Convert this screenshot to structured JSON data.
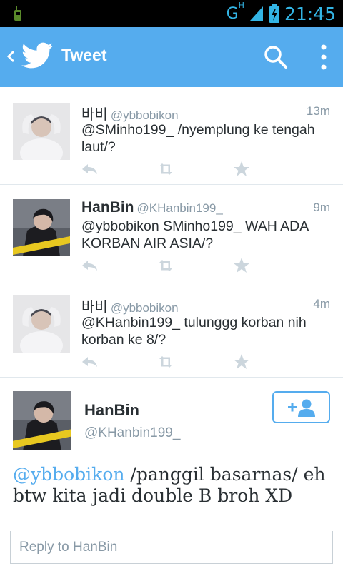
{
  "status_bar": {
    "network": "G",
    "network_sup": "H",
    "time": "21:45",
    "battery_icon": "battery-charging-icon",
    "signal_icon": "signal-icon",
    "notification_icon": "phone-icon"
  },
  "action_bar": {
    "title": "Tweet",
    "back_icon": "chevron-left-icon",
    "logo_icon": "twitter-bird-icon",
    "search_icon": "search-icon",
    "menu_icon": "overflow-menu-icon",
    "color": "#55acee"
  },
  "tweets": [
    {
      "name": "바비",
      "handle": "@ybbobikon",
      "time": "13m",
      "text": "@SMinho199_ /nyemplung ke tengah laut/?"
    },
    {
      "name": "HanBin",
      "handle": "@KHanbin199_",
      "time": "9m",
      "text": "@ybbobikon SMinho199_ WAH ADA KORBAN AIR ASIA/?"
    },
    {
      "name": "바비",
      "handle": "@ybbobikon",
      "time": "4m",
      "text": "@KHanbin199_ tulunggg korban nih korban ke 8/?"
    }
  ],
  "detail": {
    "name": "HanBin",
    "handle": "@KHanbin199_",
    "follow_icon": "add-user-icon",
    "mention": "@ybbobikon",
    "text": " /panggil basarnas/ eh btw kita jadi double B broh XD"
  },
  "reply": {
    "placeholder": "Reply to HanBin"
  },
  "action_icons": [
    "reply-icon",
    "retweet-icon",
    "favorite-star-icon"
  ],
  "icon_color": "#ccd6dd"
}
